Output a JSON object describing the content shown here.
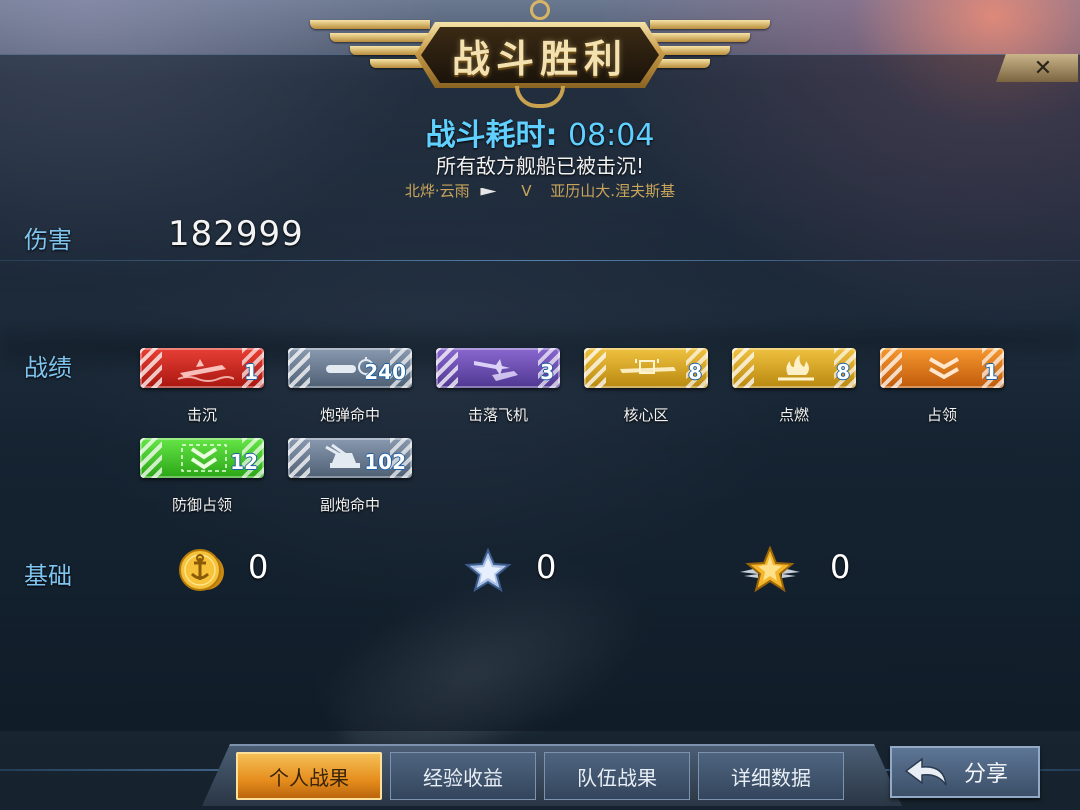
{
  "header": {
    "title": "战斗胜利",
    "duration_label": "战斗耗时:",
    "duration_time": "08:04",
    "result_text": "所有敌方舰船已被击沉!",
    "player_ship": "北烨·云雨",
    "vs_text": "V",
    "enemy_ship": "亚历山大.涅夫斯基",
    "close_glyph": "✕"
  },
  "sections": {
    "damage_label": "伤害",
    "damage_value": "182999",
    "achievements_label": "战绩",
    "base_label": "基础"
  },
  "achievements": [
    {
      "name": "击沉",
      "count": "1",
      "color": "#d4261e",
      "icon": "ship-sinking-icon"
    },
    {
      "name": "炮弹命中",
      "count": "240",
      "color": "#6c7d93",
      "icon": "shell-hit-icon"
    },
    {
      "name": "击落飞机",
      "count": "3",
      "color": "#6a4fb0",
      "icon": "plane-shot-icon"
    },
    {
      "name": "核心区",
      "count": "8",
      "color": "#d9a72a",
      "icon": "citadel-icon"
    },
    {
      "name": "点燃",
      "count": "8",
      "color": "#d9a72a",
      "icon": "fire-icon"
    },
    {
      "name": "占领",
      "count": "1",
      "color": "#e0731a",
      "icon": "capture-icon"
    },
    {
      "name": "防御占领",
      "count": "12",
      "color": "#44c42c",
      "icon": "defend-capture-icon"
    },
    {
      "name": "副炮命中",
      "count": "102",
      "color": "#6c7d93",
      "icon": "secondary-gun-icon"
    }
  ],
  "base_rewards": [
    {
      "icon": "gold-coin-icon",
      "value": "0"
    },
    {
      "icon": "silver-star-icon",
      "value": "0"
    },
    {
      "icon": "gold-star-wings-icon",
      "value": "0"
    }
  ],
  "tabs": [
    {
      "label": "个人战果",
      "active": true
    },
    {
      "label": "经验收益",
      "active": false
    },
    {
      "label": "队伍战果",
      "active": false
    },
    {
      "label": "详细数据",
      "active": false
    }
  ],
  "share_label": "分享",
  "colors": {
    "accent_blue": "#5fd0ff",
    "label_blue": "#7ec4ee",
    "gold": "#c9a55a"
  }
}
